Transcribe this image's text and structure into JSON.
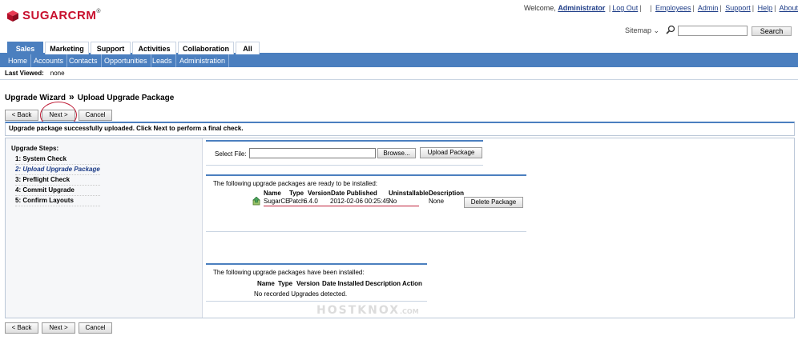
{
  "brand": {
    "name": "SUGARCRM",
    "tm": "®"
  },
  "header": {
    "welcome": "Welcome,",
    "user": "Administrator",
    "logout": "Log Out",
    "links": [
      "Employees",
      "Admin",
      "Support",
      "Help",
      "About"
    ],
    "sitemap": "Sitemap",
    "search_button": "Search",
    "search_value": ""
  },
  "tabs": {
    "items": [
      "Sales",
      "Marketing",
      "Support",
      "Activities",
      "Collaboration",
      "All"
    ],
    "active": "Sales"
  },
  "subtabs": [
    "Home",
    "Accounts",
    "Contacts",
    "Opportunities",
    "Leads",
    "Administration"
  ],
  "last_viewed": {
    "label": "Last Viewed:",
    "value": "none"
  },
  "page": {
    "title": "Upgrade Wizard",
    "sep": "»",
    "subtitle": "Upload Upgrade Package"
  },
  "buttons": {
    "back": "< Back",
    "next": "Next >",
    "cancel": "Cancel"
  },
  "message": "Upgrade package successfully uploaded. Click Next to perform a final check.",
  "steps": {
    "heading": "Upgrade Steps:",
    "items": [
      "1: System Check",
      "2: Upload Upgrade Package",
      "3: Preflight Check",
      "4: Commit Upgrade",
      "5: Confirm Layouts"
    ],
    "active_index": 1
  },
  "upload": {
    "select_label": "Select File:",
    "file_value": "",
    "browse": "Browse...",
    "upload_button": "Upload Package"
  },
  "ready": {
    "note": "The following upgrade packages are ready to be installed:",
    "columns": [
      "Name",
      "Type",
      "Version",
      "Date Published",
      "Uninstallable",
      "Description"
    ],
    "row": {
      "name": "SugarCE",
      "type": "Patch",
      "version": "6.4.0",
      "date": "2012-02-06 00:25:45",
      "uninstallable": "No",
      "description": "None"
    },
    "delete_button": "Delete Package"
  },
  "installed": {
    "note": "The following upgrade packages have been installed:",
    "columns": [
      "Name",
      "Type",
      "Version",
      "Date Installed",
      "Description",
      "Action"
    ],
    "empty": "No recorded Upgrades detected."
  },
  "watermark": {
    "text": "HOSTKNOX",
    "suffix": ".COM"
  }
}
